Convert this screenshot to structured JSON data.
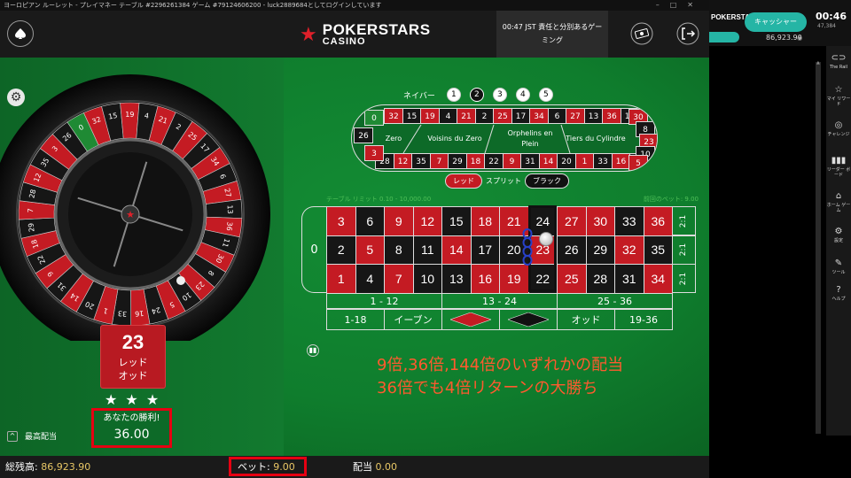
{
  "window": {
    "title": "ヨーロピアン ルーレット - プレイマネー テーブル #2296261384 ゲーム #79124606200 - luck2889684としてログインしています"
  },
  "header": {
    "logo_line1": "POKERSTARS",
    "logo_line2": "CASINO",
    "notice_line1": "00:47 JST 責任と分別あるゲー",
    "notice_line2": "ミング"
  },
  "wheel": {
    "numbers": [
      0,
      32,
      15,
      19,
      4,
      21,
      2,
      25,
      17,
      34,
      6,
      27,
      13,
      36,
      11,
      30,
      8,
      23,
      10,
      5,
      24,
      16,
      33,
      1,
      20,
      14,
      31,
      9,
      22,
      18,
      29,
      7,
      28,
      12,
      35,
      3,
      26
    ]
  },
  "result": {
    "number": "23",
    "color_label": "レッド",
    "parity_label": "オッド"
  },
  "win": {
    "label": "あなたの勝利!",
    "amount": "36.00"
  },
  "highest_payout_label": "最高配当",
  "neighbors": {
    "label": "ネイバー",
    "options": [
      "1",
      "2",
      "3",
      "4",
      "5"
    ],
    "selected": "2"
  },
  "racetrack": {
    "top": [
      "32",
      "15",
      "19",
      "4",
      "21",
      "2",
      "25",
      "17",
      "34",
      "6",
      "27",
      "13",
      "36",
      "11"
    ],
    "bottom": [
      "28",
      "12",
      "35",
      "7",
      "29",
      "18",
      "22",
      "9",
      "31",
      "14",
      "20",
      "1",
      "33",
      "16",
      "24"
    ],
    "zones": [
      "Zero",
      "Voisins du Zero",
      "Orphelins en Plein",
      "Tiers du Cylindre"
    ],
    "left_nums": [
      "0",
      "26",
      "3"
    ],
    "right_nums": [
      "30",
      "8",
      "23",
      "10",
      "5"
    ]
  },
  "color_toggle": {
    "red": "レッド",
    "split": "スプリット",
    "black": "ブラック"
  },
  "limits": {
    "table": "テーブル リミット 0.10 - 10,000.00",
    "previous_bet": "前回のベット: 9.00"
  },
  "grid": {
    "zero": "0",
    "rows": [
      [
        3,
        6,
        9,
        12,
        15,
        18,
        21,
        24,
        27,
        30,
        33,
        36
      ],
      [
        2,
        5,
        8,
        11,
        14,
        17,
        20,
        23,
        26,
        29,
        32,
        35
      ],
      [
        1,
        4,
        7,
        10,
        13,
        16,
        19,
        22,
        25,
        28,
        31,
        34
      ]
    ],
    "red_numbers": [
      1,
      3,
      5,
      7,
      9,
      12,
      14,
      16,
      18,
      19,
      21,
      23,
      25,
      27,
      30,
      32,
      34,
      36
    ],
    "column_label": "2:1",
    "dozens": [
      "1 - 12",
      "13 - 24",
      "25 - 36"
    ],
    "outside": [
      "1-18",
      "イーブン",
      "",
      "",
      "オッド",
      "19-36"
    ]
  },
  "annotation": {
    "line1": "9倍,36倍,144倍のいずれかの配当",
    "line2": "36倍でも4倍リターンの大勝ち"
  },
  "bottom": {
    "balance_label": "総残高:",
    "balance_value": "86,923.90",
    "bet_label": "ベット:",
    "bet_value": "9.00",
    "payout_label": "配当",
    "payout_value": "0.00"
  },
  "right_panel": {
    "logo": "POKERSTARS",
    "cashier": "キャッシャー",
    "balance": "86,923.90",
    "clock": "00:46",
    "clock_sub": "47,384",
    "sidebar": [
      {
        "icon": "rail-icon",
        "label": "The Rail"
      },
      {
        "icon": "star-icon",
        "label": "マイ リワード"
      },
      {
        "icon": "target-icon",
        "label": "チャレンジ"
      },
      {
        "icon": "leaderboard-icon",
        "label": "リーダー ボード"
      },
      {
        "icon": "home-icon",
        "label": "ホーム ゲーム"
      },
      {
        "icon": "gear-icon",
        "label": "設定"
      },
      {
        "icon": "tools-icon",
        "label": "ツール"
      },
      {
        "icon": "help-icon",
        "label": "ヘルプ"
      }
    ]
  },
  "colors": {
    "red": "#c41b23",
    "black": "#161616",
    "felt": "#0f7d2d",
    "annotation": "#ff5a2e",
    "highlight": "#e60012",
    "teal": "#25b5a5"
  }
}
